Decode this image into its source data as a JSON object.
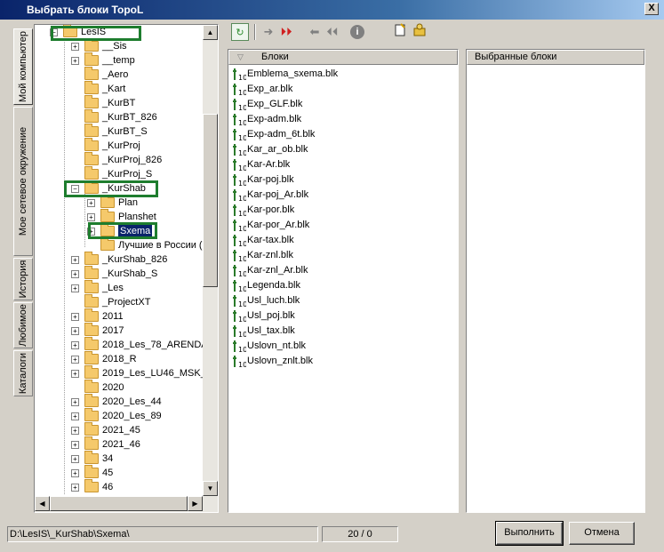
{
  "window": {
    "title": "Выбрать блоки TopoL",
    "close_label": "X"
  },
  "tabs": [
    "Мой компьютер",
    "Мое сетевое окружение",
    "История",
    "Любимое",
    "Каталоги"
  ],
  "tree": {
    "items": [
      {
        "label": "LesIS",
        "expand": "−"
      },
      {
        "label": "__Sis",
        "expand": "+"
      },
      {
        "label": "__temp",
        "expand": "+"
      },
      {
        "label": "_Aero",
        "expand": ""
      },
      {
        "label": "_Kart",
        "expand": ""
      },
      {
        "label": "_KurBT",
        "expand": ""
      },
      {
        "label": "_KurBT_826",
        "expand": ""
      },
      {
        "label": "_KurBT_S",
        "expand": ""
      },
      {
        "label": "_KurProj",
        "expand": ""
      },
      {
        "label": "_KurProj_826",
        "expand": ""
      },
      {
        "label": "_KurProj_S",
        "expand": ""
      },
      {
        "label": "_KurShab",
        "expand": "−"
      },
      {
        "label": "Plan",
        "expand": "+"
      },
      {
        "label": "Planshet",
        "expand": "+"
      },
      {
        "label": "Sxema",
        "expand": "+"
      },
      {
        "label": "Лучшие в России (",
        "expand": ""
      },
      {
        "label": "_KurShab_826",
        "expand": "+"
      },
      {
        "label": "_KurShab_S",
        "expand": "+"
      },
      {
        "label": "_Les",
        "expand": "+"
      },
      {
        "label": "_ProjectXT",
        "expand": ""
      },
      {
        "label": "2011",
        "expand": "+"
      },
      {
        "label": "2017",
        "expand": "+"
      },
      {
        "label": "2018_Les_78_ARENDA",
        "expand": "+"
      },
      {
        "label": "2018_R",
        "expand": "+"
      },
      {
        "label": "2019_Les_LU46_MSK_",
        "expand": "+"
      },
      {
        "label": "2020",
        "expand": ""
      },
      {
        "label": "2020_Les_44",
        "expand": "+"
      },
      {
        "label": "2020_Les_89",
        "expand": "+"
      },
      {
        "label": "2021_45",
        "expand": "+"
      },
      {
        "label": "2021_46",
        "expand": "+"
      },
      {
        "label": "34",
        "expand": "+"
      },
      {
        "label": "45",
        "expand": "+"
      },
      {
        "label": "46",
        "expand": "+"
      }
    ]
  },
  "toolbar": {
    "icons": [
      "refresh-icon",
      "arrow-right-icon",
      "double-arrow-right-icon",
      "arrow-left-icon",
      "double-arrow-left-icon",
      "info-icon",
      "new-file-icon",
      "settings-icon"
    ]
  },
  "blocks": {
    "header": "Блоки",
    "items": [
      "Emblema_sxema.blk",
      "Exp_ar.blk",
      "Exp_GLF.blk",
      "Exp-adm.blk",
      "Exp-adm_6t.blk",
      "Kar_ar_ob.blk",
      "Kar-Ar.blk",
      "Kar-poj.blk",
      "Kar-poj_Ar.blk",
      "Kar-por.blk",
      "Kar-por_Ar.blk",
      "Kar-tax.blk",
      "Kar-znl.blk",
      "Kar-znl_Ar.blk",
      "Legenda.blk",
      "Usl_luch.blk",
      "Usl_poj.blk",
      "Usl_tax.blk",
      "Uslovn_nt.blk",
      "Uslovn_znlt.blk"
    ]
  },
  "selected": {
    "header": "Выбранные блоки"
  },
  "status": {
    "path": "D:\\LesIS\\_KurShab\\Sxema\\",
    "count": "20 / 0"
  },
  "buttons": {
    "execute": "Выполнить",
    "cancel": "Отмена"
  },
  "colors": {
    "highlight_border": "#1e7d2e",
    "selection": "#0a246a",
    "titlebar": "#0a246a"
  }
}
